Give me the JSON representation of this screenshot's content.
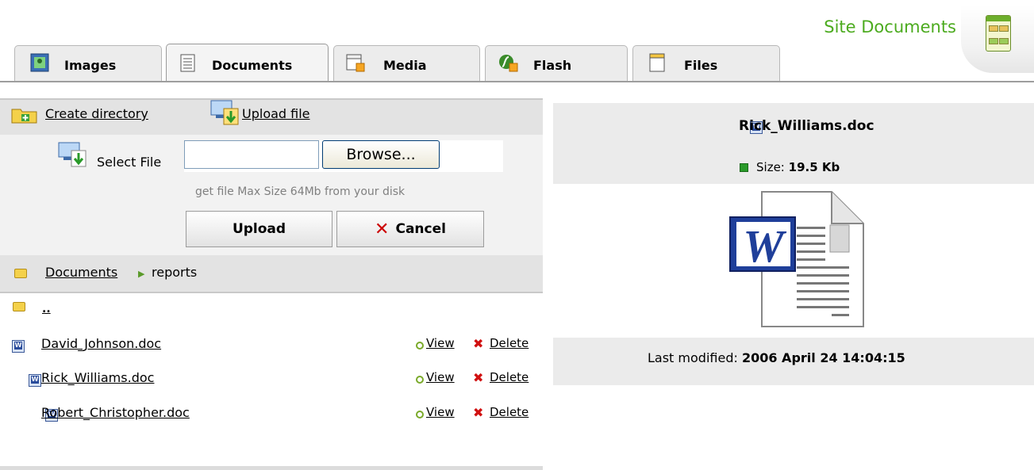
{
  "header": {
    "title": "Site Documents",
    "title_color": "#4cab1f"
  },
  "tabs": [
    {
      "label": "Images",
      "icon": "image-icon"
    },
    {
      "label": "Documents",
      "icon": "document-icon",
      "active": true
    },
    {
      "label": "Media",
      "icon": "media-icon"
    },
    {
      "label": "Flash",
      "icon": "flash-icon"
    },
    {
      "label": "Files",
      "icon": "files-icon"
    }
  ],
  "toolbar": {
    "create_directory": "Create directory",
    "upload_file": "Upload file"
  },
  "upload": {
    "select_label": "Select File",
    "file_value": "",
    "browse_label": "Browse...",
    "hint": "get file Max Size 64Mb from your disk",
    "upload_label": "Upload",
    "cancel_label": "Cancel"
  },
  "breadcrumb": {
    "root": "Documents",
    "current": "reports"
  },
  "files": {
    "parent_label": "..",
    "view_label": "View",
    "delete_label": "Delete",
    "items": [
      {
        "name": "David_Johnson.doc"
      },
      {
        "name": "Rick_Williams.doc"
      },
      {
        "name": "Robert_Christopher.doc"
      }
    ]
  },
  "preview": {
    "file_name": "Rick_Williams.doc",
    "size_label": "Size:",
    "size_value": "19.5 Kb",
    "modified_label": "Last modified:",
    "modified_value": "2006 April 24 14:04:15"
  }
}
